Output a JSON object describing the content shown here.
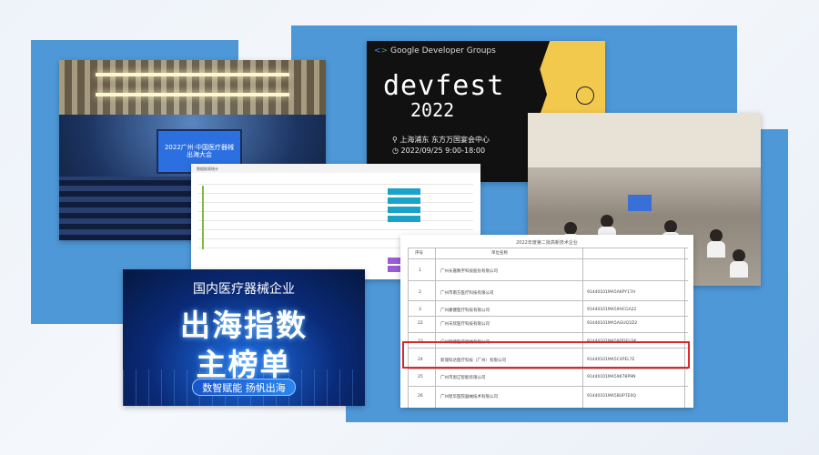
{
  "colors": {
    "panel_blue": "#4e98d8",
    "highlight_red": "#e0262b",
    "devfest_yellow": "#f2c94c",
    "banner_blue": "#0a2a78"
  },
  "hall_photo": {
    "screen_text": "2022广州·中国医疗器械出海大会"
  },
  "devfest": {
    "brand": "Google Developer Groups",
    "title": "devfest",
    "year": "2022",
    "location": "上海浦东 东方万国宴会中心",
    "time": "2022/09/25 9:00-18:00"
  },
  "spreadsheet": {
    "heading": "数据报表统计"
  },
  "table": {
    "title": "2022年度第二批高新技术企业",
    "header_no": "序号",
    "header_name": "单位名称",
    "rows": [
      {
        "no": "1",
        "name": "广州长嘉数字科技股份有限公司",
        "code": ""
      },
      {
        "no": "2",
        "name": "广州市南方医疗科技有限公司",
        "code": "91440101MA5AKPY17H"
      },
      {
        "no": "3",
        "name": "广州康健医疗科技有限公司",
        "code": "91440101MA59HCGA22"
      },
      {
        "no": "22",
        "name": "广州天欣医疗科技有限公司",
        "code": "91440101MA5AGUQ1D2"
      },
      {
        "no": "23",
        "name": "广州瑞德医疗器械有限公司",
        "code": "91440101MA59DDEU3K"
      },
      {
        "no": "24",
        "name": "新瑞科达医疗科技（广州）有限公司",
        "code": "91440101MA5C4PEL7E"
      },
      {
        "no": "25",
        "name": "广州市恩辽智能有限公司",
        "code": "91440101MA59K7BP9N"
      },
      {
        "no": "26",
        "name": "广州智华医院器械技术有限公司",
        "code": "91440101MA5BUP7E0Q"
      }
    ]
  },
  "banner": {
    "top": "国内医疗器械企业",
    "line1": "出海指数",
    "line2": "主榜单",
    "sub": "数智赋能 扬帆出海"
  }
}
